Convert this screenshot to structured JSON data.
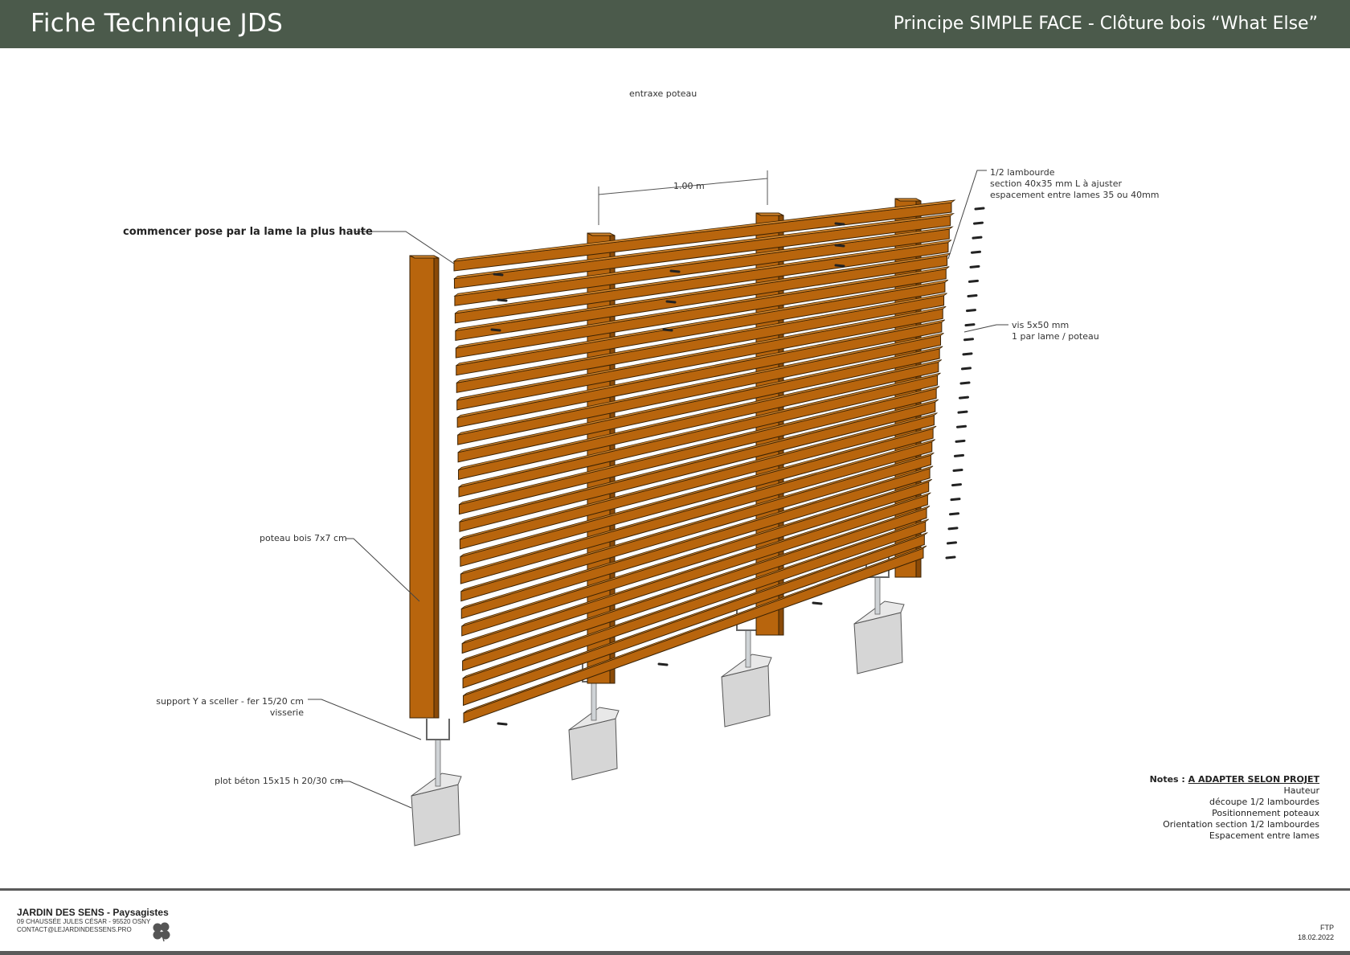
{
  "header": {
    "title": "Fiche Technique JDS",
    "subtitle": "Principe SIMPLE FACE - Clôture bois “What Else”",
    "background_color": "#4b5a4b"
  },
  "labels": {
    "entraxe": "entraxe poteau",
    "dimension": "1.00 m",
    "commencer": "commencer pose par la lame la plus haute",
    "lambourde_1": "1/2 lambourde",
    "lambourde_2": "section 40x35 mm L à ajuster",
    "lambourde_3": "espacement entre lames 35 ou 40mm",
    "vis_1": "vis 5x50 mm",
    "vis_2": "1 par lame / poteau",
    "poteau": "poteau bois 7x7 cm",
    "support_1": "support Y a sceller  - fer 15/20 cm",
    "support_2": "visserie",
    "plot": "plot béton 15x15 h 20/30 cm"
  },
  "notes": {
    "prefix": "Notes : ",
    "title": "A  ADAPTER SELON PROJET",
    "items": [
      "Hauteur",
      "découpe 1/2 lambourdes",
      "Positionnement poteaux",
      "Orientation section 1/2 lambourdes",
      "Espacement entre lames"
    ]
  },
  "footer": {
    "company": "JARDIN DES SENS",
    "company_suffix": " - Paysagistes",
    "address": "09 CHAUSSÉE JULES CÉSAR - 95520 OSNY",
    "contact": "CONTACT@LEJARDINDESSENS.PRO",
    "doc_code": "FTP",
    "date": "18.02.2022"
  },
  "colors": {
    "wood_front": "#b8650d",
    "wood_top": "#d98a2e",
    "wood_dark": "#8a4a08",
    "concrete": "#d6d6d6",
    "concrete_top": "#e8e8e8",
    "concrete_side": "#bdbdbd"
  }
}
